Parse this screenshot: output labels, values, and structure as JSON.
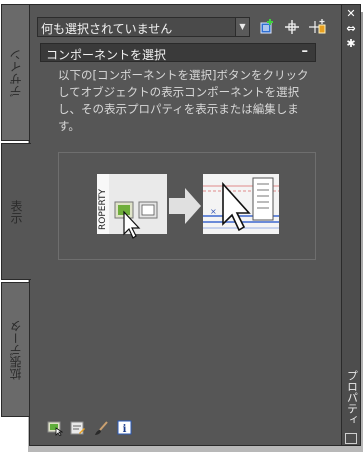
{
  "select": {
    "value": "何も選択されていません"
  },
  "tabs": [
    {
      "label": "デザイン"
    },
    {
      "label": "表示"
    },
    {
      "label": "拡張データ"
    }
  ],
  "section": {
    "title": "コンポーネントを選択",
    "collapse": "–",
    "description": "以下の[コンポーネントを選択]ボタンをクリックしてオブジェクトの表示コンポーネントを選択し、その表示プロパティを表示または編集します。"
  },
  "figure": {
    "left_label": "ROPERTY"
  },
  "titlebar": {
    "title": "プロパティ",
    "close": "✕",
    "autohide": "⇔",
    "settings": "✱"
  },
  "icons": {
    "toolbar": [
      "quick-select-icon",
      "select-objects-icon",
      "toggle-pickadd-icon"
    ],
    "bottom": [
      "select-component-icon",
      "edit-display-icon",
      "style-brush-icon",
      "info-icon"
    ]
  },
  "colors": {
    "panel": "#565656",
    "tab_inactive": "#6a6a6a",
    "header": "#3a3a3a",
    "text": "#d8d8d8"
  }
}
